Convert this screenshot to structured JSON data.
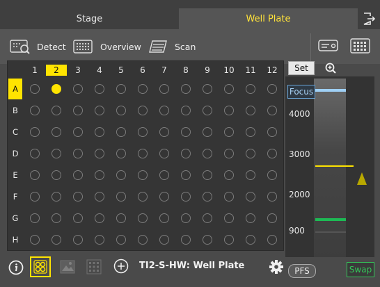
{
  "tabs": {
    "stage": "Stage",
    "well_plate": "Well Plate"
  },
  "toolbar": {
    "detect": "Detect",
    "overview": "Overview",
    "scan": "Scan"
  },
  "plate": {
    "columns": [
      "1",
      "2",
      "3",
      "4",
      "5",
      "6",
      "7",
      "8",
      "9",
      "10",
      "11",
      "12"
    ],
    "rows": [
      "A",
      "B",
      "C",
      "D",
      "E",
      "F",
      "G",
      "H"
    ],
    "selected_column": "2",
    "selected_row": "A",
    "selected_well": "A2"
  },
  "focus": {
    "set_label": "Set",
    "focus_label": "Focus",
    "ticks": [
      "4000",
      "3000",
      "2000",
      "900"
    ],
    "pfs_label": "PFS",
    "swap_label": "Swap",
    "colors": {
      "focus_line": "#9fd0f5",
      "current_line": "#ffe400",
      "pfs_line": "#1db954",
      "marker": "#b8a800"
    }
  },
  "bottom": {
    "plate_name": "TI2-S-HW: Well Plate"
  },
  "colors": {
    "accent": "#ffe400",
    "background": "#4a4a4a"
  }
}
